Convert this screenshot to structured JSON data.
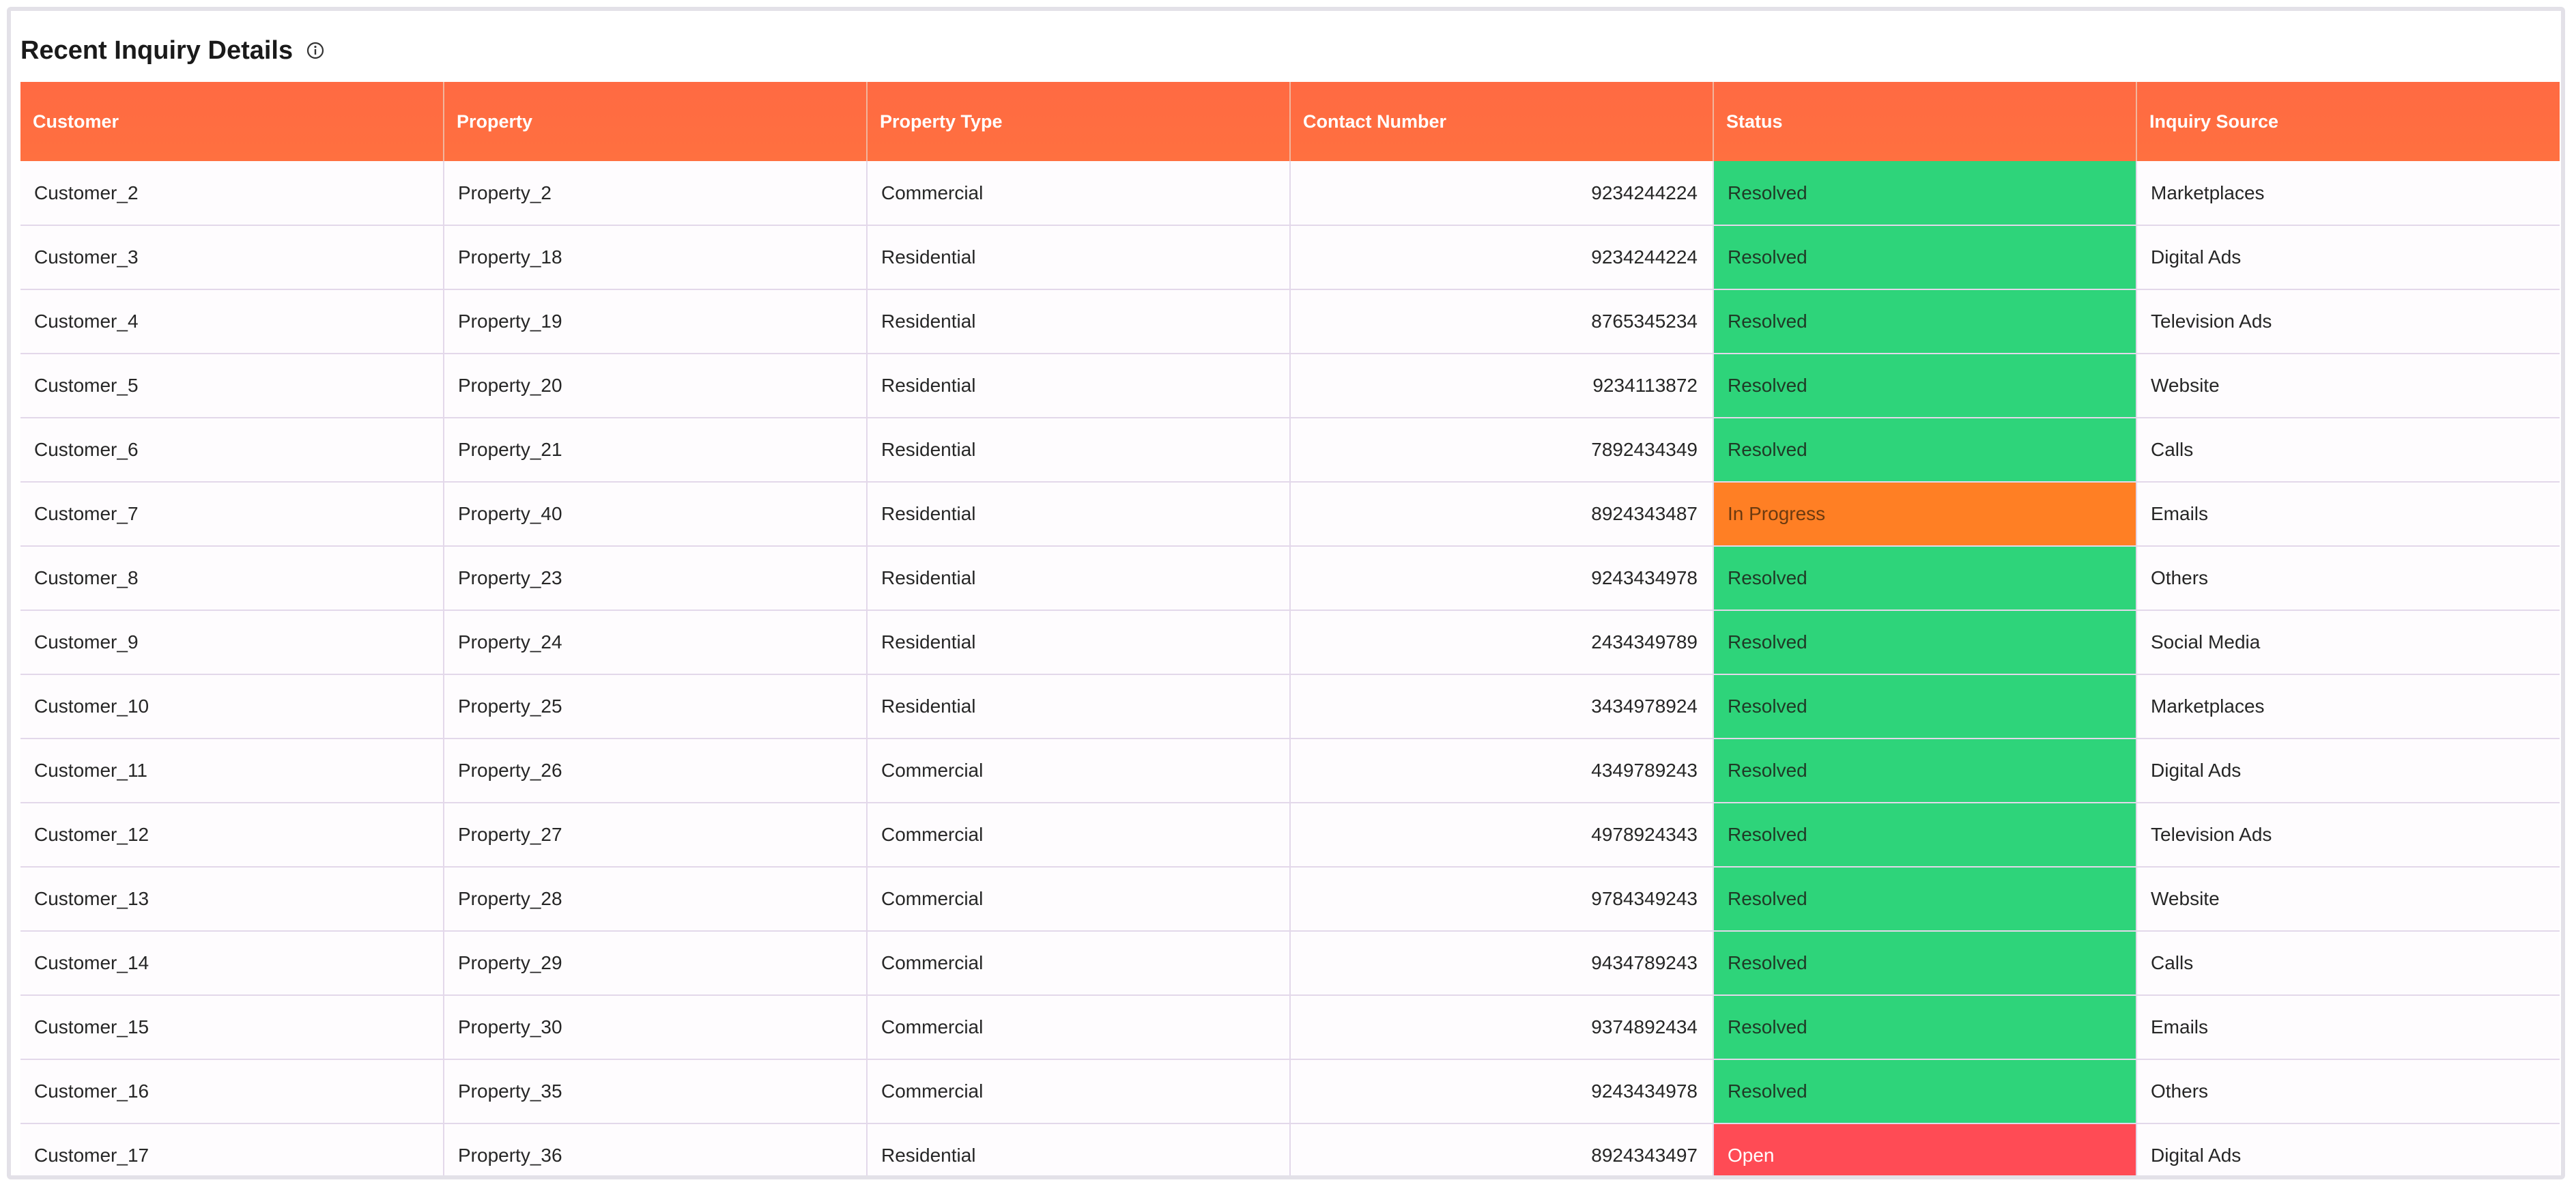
{
  "header": {
    "title": "Recent Inquiry Details",
    "info_icon": "info-circle-icon"
  },
  "colors": {
    "header_bg": "#ff6b41",
    "resolved": "#2ed47a",
    "in_progress": "#ff7f24",
    "open": "#ff4b55"
  },
  "table": {
    "columns": [
      "Customer",
      "Property",
      "Property Type",
      "Contact Number",
      "Status",
      "Inquiry Source"
    ],
    "rows": [
      {
        "customer": "Customer_2",
        "property": "Property_2",
        "type": "Commercial",
        "contact": "9234244224",
        "status": "Resolved",
        "source": "Marketplaces"
      },
      {
        "customer": "Customer_3",
        "property": "Property_18",
        "type": "Residential",
        "contact": "9234244224",
        "status": "Resolved",
        "source": "Digital Ads"
      },
      {
        "customer": "Customer_4",
        "property": "Property_19",
        "type": "Residential",
        "contact": "8765345234",
        "status": "Resolved",
        "source": "Television Ads"
      },
      {
        "customer": "Customer_5",
        "property": "Property_20",
        "type": "Residential",
        "contact": "9234113872",
        "status": "Resolved",
        "source": "Website"
      },
      {
        "customer": "Customer_6",
        "property": "Property_21",
        "type": "Residential",
        "contact": "7892434349",
        "status": "Resolved",
        "source": "Calls"
      },
      {
        "customer": "Customer_7",
        "property": "Property_40",
        "type": "Residential",
        "contact": "8924343487",
        "status": "In Progress",
        "source": "Emails"
      },
      {
        "customer": "Customer_8",
        "property": "Property_23",
        "type": "Residential",
        "contact": "9243434978",
        "status": "Resolved",
        "source": "Others"
      },
      {
        "customer": "Customer_9",
        "property": "Property_24",
        "type": "Residential",
        "contact": "2434349789",
        "status": "Resolved",
        "source": "Social Media"
      },
      {
        "customer": "Customer_10",
        "property": "Property_25",
        "type": "Residential",
        "contact": "3434978924",
        "status": "Resolved",
        "source": "Marketplaces"
      },
      {
        "customer": "Customer_11",
        "property": "Property_26",
        "type": "Commercial",
        "contact": "4349789243",
        "status": "Resolved",
        "source": "Digital Ads"
      },
      {
        "customer": "Customer_12",
        "property": "Property_27",
        "type": "Commercial",
        "contact": "4978924343",
        "status": "Resolved",
        "source": "Television Ads"
      },
      {
        "customer": "Customer_13",
        "property": "Property_28",
        "type": "Commercial",
        "contact": "9784349243",
        "status": "Resolved",
        "source": "Website"
      },
      {
        "customer": "Customer_14",
        "property": "Property_29",
        "type": "Commercial",
        "contact": "9434789243",
        "status": "Resolved",
        "source": "Calls"
      },
      {
        "customer": "Customer_15",
        "property": "Property_30",
        "type": "Commercial",
        "contact": "9374892434",
        "status": "Resolved",
        "source": "Emails"
      },
      {
        "customer": "Customer_16",
        "property": "Property_35",
        "type": "Commercial",
        "contact": "9243434978",
        "status": "Resolved",
        "source": "Others"
      },
      {
        "customer": "Customer_17",
        "property": "Property_36",
        "type": "Residential",
        "contact": "8924343497",
        "status": "Open",
        "source": "Digital Ads"
      }
    ]
  }
}
